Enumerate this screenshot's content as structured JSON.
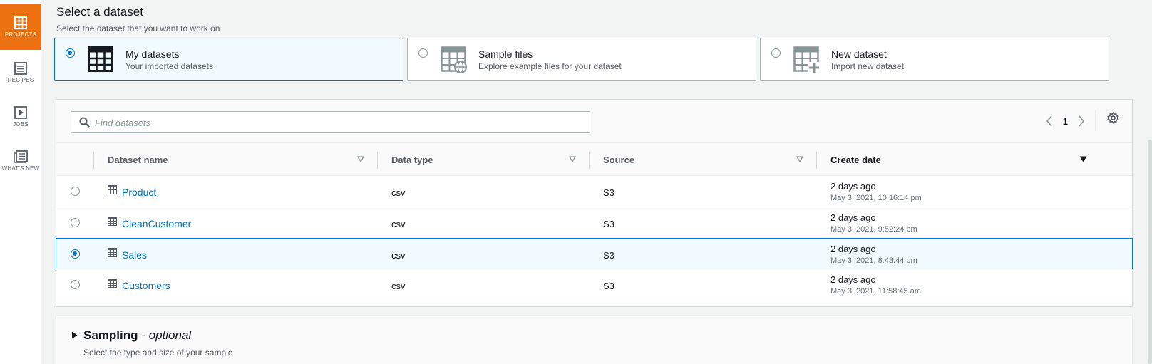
{
  "nav": {
    "items": [
      {
        "label": "PROJECTS",
        "icon": "projects-grid-icon",
        "active": true
      },
      {
        "label": "RECIPES",
        "icon": "recipe-list-icon",
        "active": false
      },
      {
        "label": "JOBS",
        "icon": "play-job-icon",
        "active": false
      },
      {
        "label": "WHAT'S NEW",
        "icon": "news-icon",
        "active": false
      }
    ]
  },
  "section": {
    "title": "Select a dataset",
    "subtitle": "Select the dataset that you want to work on"
  },
  "tiles": [
    {
      "name": "My datasets",
      "desc": "Your imported datasets",
      "selected": true
    },
    {
      "name": "Sample files",
      "desc": "Explore example files for your dataset",
      "selected": false
    },
    {
      "name": "New dataset",
      "desc": "Import new dataset",
      "selected": false
    }
  ],
  "search": {
    "placeholder": "Find datasets",
    "value": ""
  },
  "pagination": {
    "page": "1"
  },
  "table": {
    "columns": {
      "name": "Dataset name",
      "type": "Data type",
      "source": "Source",
      "date": "Create date"
    },
    "sorted_column": "Create date",
    "rows": [
      {
        "name": "Product",
        "type": "csv",
        "source": "S3",
        "relative": "2 days ago",
        "absolute": "May 3, 2021, 10:16:14 pm",
        "selected": false
      },
      {
        "name": "CleanCustomer",
        "type": "csv",
        "source": "S3",
        "relative": "2 days ago",
        "absolute": "May 3, 2021, 9:52:24 pm",
        "selected": false
      },
      {
        "name": "Sales",
        "type": "csv",
        "source": "S3",
        "relative": "2 days ago",
        "absolute": "May 3, 2021, 8:43:44 pm",
        "selected": true
      },
      {
        "name": "Customers",
        "type": "csv",
        "source": "S3",
        "relative": "2 days ago",
        "absolute": "May 3, 2021, 11:58:45 am",
        "selected": false
      }
    ]
  },
  "sampling": {
    "title": "Sampling",
    "optional": " - optional",
    "desc": "Select the type and size of your sample"
  },
  "colors": {
    "accent": "#ec7211",
    "link": "#0073bb",
    "selected_bg": "#f1faff"
  }
}
